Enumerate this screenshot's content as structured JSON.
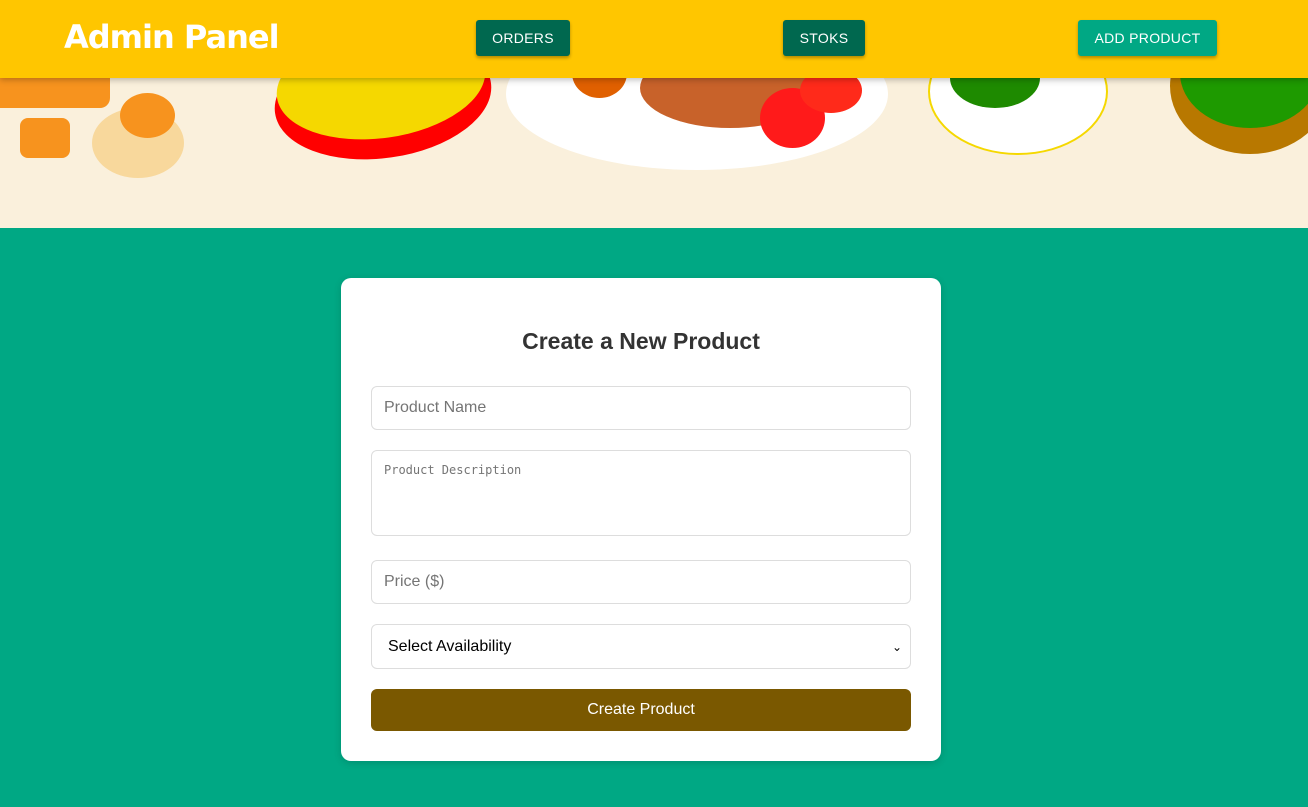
{
  "header": {
    "title": "Admin Panel",
    "nav": [
      {
        "label": "ORDERS"
      },
      {
        "label": "STOKS"
      },
      {
        "label": "ADD PRODUCT"
      }
    ]
  },
  "form": {
    "title": "Create a New Product",
    "name_placeholder": "Product Name",
    "description_placeholder": "Product Description",
    "price_placeholder": "Price ($)",
    "availability_selected": "Select Availability",
    "submit_label": "Create Product"
  },
  "colors": {
    "header": "#ffc600",
    "nav_dark": "#00684f",
    "accent": "#00a884",
    "banner": "#faf0dc",
    "submit": "#7a5800"
  }
}
